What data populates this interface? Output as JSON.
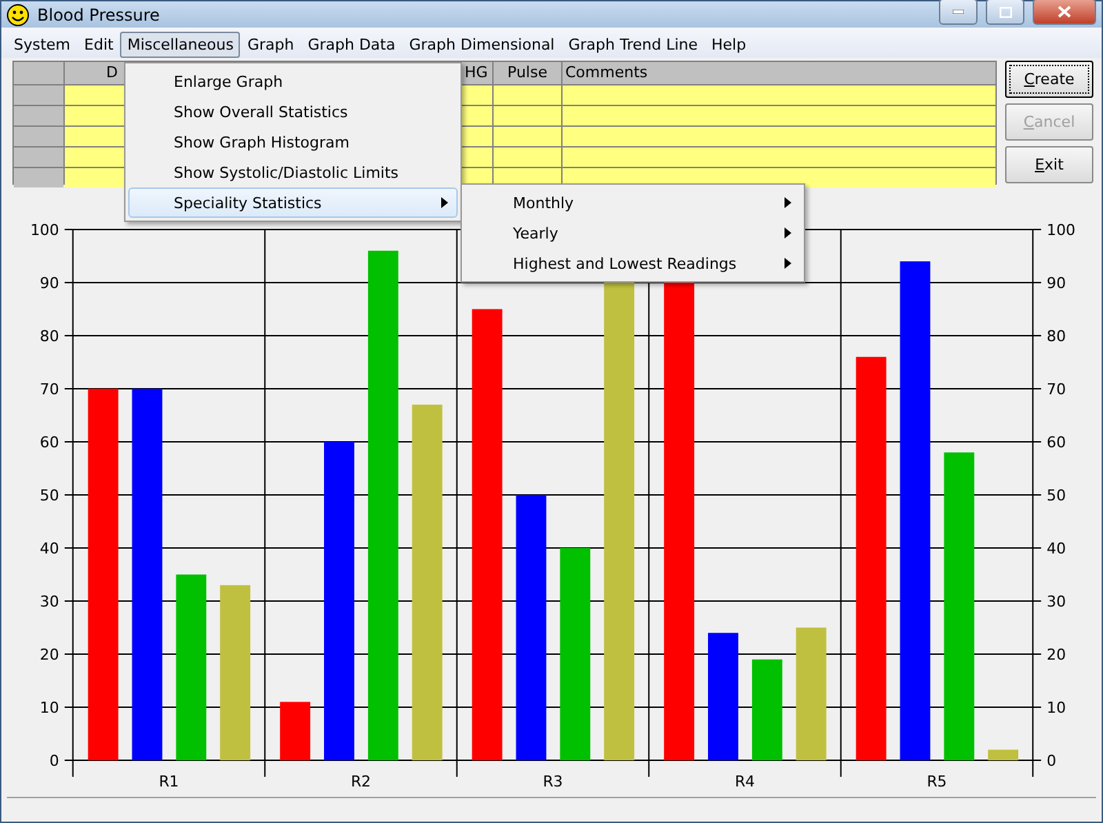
{
  "window": {
    "title": "Blood Pressure"
  },
  "menu_bar": [
    {
      "label": "System",
      "selected": false
    },
    {
      "label": "Edit",
      "selected": false
    },
    {
      "label": "Miscellaneous",
      "selected": true
    },
    {
      "label": "Graph",
      "selected": false
    },
    {
      "label": "Graph Data",
      "selected": false
    },
    {
      "label": "Graph Dimensional",
      "selected": false
    },
    {
      "label": "Graph Trend Line",
      "selected": false
    },
    {
      "label": "Help",
      "selected": false
    }
  ],
  "dropdown": {
    "items": [
      {
        "label": "Enlarge Graph",
        "highlighted": false,
        "has_submenu": false
      },
      {
        "label": "Show Overall Statistics",
        "highlighted": false,
        "has_submenu": false
      },
      {
        "label": "Show Graph Histogram",
        "highlighted": false,
        "has_submenu": false
      },
      {
        "label": "Show Systolic/Diastolic Limits",
        "highlighted": false,
        "has_submenu": false
      },
      {
        "label": "Speciality Statistics",
        "highlighted": true,
        "has_submenu": true
      }
    ]
  },
  "submenu": {
    "items": [
      {
        "label": "Monthly",
        "has_submenu": true
      },
      {
        "label": "Yearly",
        "has_submenu": true
      },
      {
        "label": "Highest and Lowest Readings",
        "has_submenu": true
      }
    ]
  },
  "grid": {
    "columns": [
      {
        "label": "D"
      },
      {
        "label": "HG"
      },
      {
        "label": "Pulse"
      },
      {
        "label": "Comments"
      }
    ]
  },
  "buttons": [
    {
      "label": "Create",
      "disabled": false,
      "default": true
    },
    {
      "label": "Cancel",
      "disabled": true,
      "default": false
    },
    {
      "label": "Exit",
      "disabled": false,
      "default": false
    }
  ],
  "chart": {
    "chart_data": {
      "type": "bar",
      "grid": true,
      "categories": [
        "R1",
        "R2",
        "R3",
        "R4",
        "R5"
      ],
      "ylim": [
        0,
        100
      ],
      "yticks": [
        0,
        10,
        20,
        30,
        40,
        50,
        60,
        70,
        80,
        90,
        100
      ],
      "y2lim": [
        0,
        100
      ],
      "y2ticks": [
        0,
        10,
        20,
        30,
        40,
        50,
        60,
        70,
        80,
        90,
        100
      ],
      "series": [
        {
          "color": "#ff0000",
          "values": [
            70,
            11,
            85,
            90,
            76
          ]
        },
        {
          "color": "#0000ff",
          "values": [
            70,
            60,
            50,
            24,
            94
          ]
        },
        {
          "color": "#00c000",
          "values": [
            35,
            96,
            40,
            19,
            58
          ]
        },
        {
          "color": "#c0c040",
          "values": [
            33,
            67,
            90,
            25,
            2
          ]
        }
      ]
    }
  }
}
